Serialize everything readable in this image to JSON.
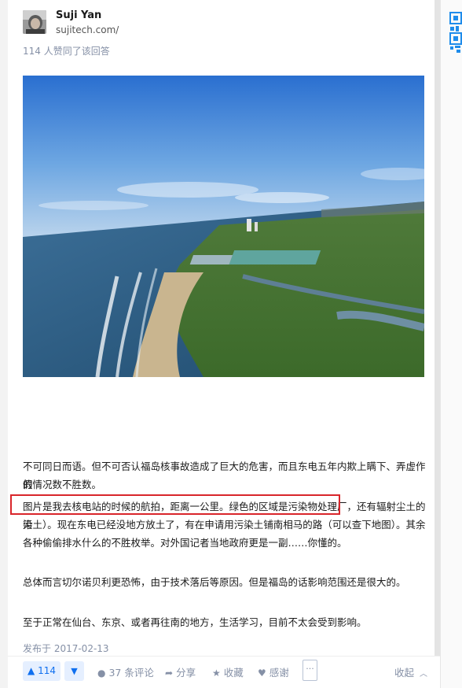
{
  "author": {
    "name": "Suji Yan",
    "website": "sujitech.com/"
  },
  "votes_summary": "114 人赞同了该回答",
  "paragraphs": [
    "不可同日而语。但不可否认福岛核事故造成了巨大的危害，而且东电五年内欺上瞒下、弄虚作假",
    "的情况数不胜数。",
    "图片是我去核电站的时候的航拍，距离一公里。绿色的区域是污染物处理厂，还有辐射尘土的污",
    "染土）。现在东电已经没地方放土了，有在申请用污染土铺南相马的路（可以查下地图）。其余",
    "各种偷偷排水什么的不胜枚举。对外国记者当地政府更是一副……你懂的。",
    "总体而言切尔诺贝利更恐怖，由于技术落后等原因。但是福岛的话影响范围还是很大的。",
    "至于正常在仙台、东京、或者再往南的地方，生活学习，目前不太会受到影响。"
  ],
  "published": "发布于 2017-02-13",
  "actions": {
    "upvote": "114",
    "comments": "37 条评论",
    "share": "分享",
    "favorite": "收藏",
    "thanks": "感谢",
    "more": "···",
    "collapse": "收起"
  },
  "colors": {
    "accent": "#0f6fef",
    "accent_bg": "#e5efff",
    "highlight_border": "#d9262b",
    "muted": "#8590a6"
  }
}
